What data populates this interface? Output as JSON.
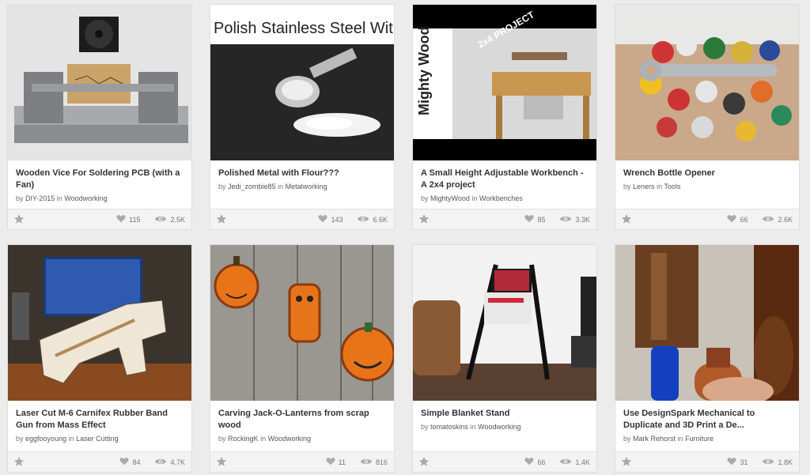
{
  "cards": [
    {
      "title": "Wooden Vice For Soldering PCB (with a Fan)",
      "author": "DIY-2015",
      "category": "Woodworking",
      "favorites": "115",
      "views": "2.5K"
    },
    {
      "title": "Polished Metal with Flour???",
      "author": "Jedi_zombie85",
      "category": "Metalworking",
      "favorites": "143",
      "views": "6.6K",
      "image_text": "Polish Stainless Steel With Flour"
    },
    {
      "title": "A Small Height Adjustable Workbench - A 2x4 project",
      "author": "MightyWood",
      "category": "Workbenches",
      "favorites": "85",
      "views": "3.3K",
      "logo_text": "Mighty Wood",
      "badge_text": "2x4 PROJECT"
    },
    {
      "title": "Wrench Bottle Opener",
      "author": "Leners",
      "category": "Tools",
      "favorites": "66",
      "views": "2.6K"
    },
    {
      "title": "Laser Cut M-6 Carnifex Rubber Band Gun from Mass Effect",
      "author": "eggfooyoung",
      "category": "Laser Cutting",
      "favorites": "84",
      "views": "4.7K"
    },
    {
      "title": "Carving Jack-O-Lanterns from scrap wood",
      "author": "RockingK",
      "category": "Woodworking",
      "favorites": "11",
      "views": "816"
    },
    {
      "title": "Simple Blanket Stand",
      "author": "tomatoskins",
      "category": "Woodworking",
      "favorites": "66",
      "views": "1.4K"
    },
    {
      "title": "Use DesignSpark Mechanical to Duplicate and 3D Print a De...",
      "author": "Mark Rehorst",
      "category": "Furniture",
      "favorites": "31",
      "views": "1.8K"
    }
  ],
  "labels": {
    "by": "by",
    "in": "in"
  },
  "icons": {
    "favorite": "heart-icon",
    "views": "eye-icon",
    "save": "star-icon"
  },
  "colors": {
    "background": "#ececec",
    "card": "#ffffff",
    "footer": "#f3f3f3",
    "title": "#333333",
    "meta": "#777777",
    "icon": "#aaaaaa"
  }
}
